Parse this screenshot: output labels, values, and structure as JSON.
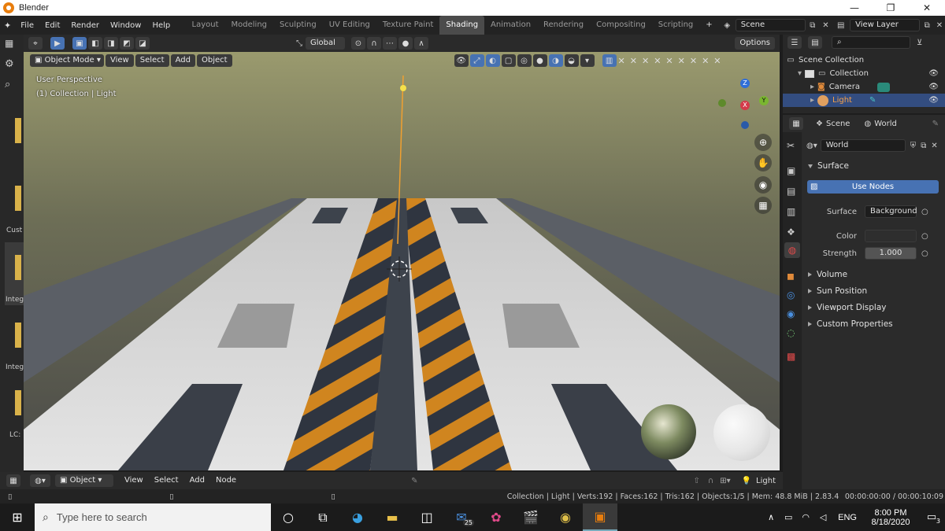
{
  "window": {
    "title": "Blender",
    "minimize": "—",
    "restore": "❐",
    "close": "✕"
  },
  "menu": [
    "File",
    "Edit",
    "Render",
    "Window",
    "Help"
  ],
  "workspaces": [
    "Layout",
    "Modeling",
    "Sculpting",
    "UV Editing",
    "Texture Paint",
    "Shading",
    "Animation",
    "Rendering",
    "Compositing",
    "Scripting"
  ],
  "active_workspace": "Shading",
  "add_tab": "+",
  "scene_field": "Scene",
  "view_layer_field": "View Layer",
  "viewport": {
    "transform_orientation": "Global",
    "options_label": "Options",
    "mode": "Object Mode",
    "menus": [
      "View",
      "Select",
      "Add",
      "Object"
    ],
    "perspective_label": "User Perspective",
    "collection_label": "(1) Collection | Light",
    "gizmo": {
      "z": "Z",
      "x": "X",
      "y": "Y"
    }
  },
  "left_strip_labels": [
    "Cust",
    "Integ",
    "Integ",
    "LC:"
  ],
  "outliner": {
    "root": "Scene Collection",
    "rows": [
      {
        "name": "Collection",
        "selected": false
      },
      {
        "name": "Camera",
        "selected": false
      },
      {
        "name": "Light",
        "selected": true
      }
    ]
  },
  "properties": {
    "breadcrumb_scene": "Scene",
    "breadcrumb_world": "World",
    "world_field": "World",
    "surface_section": "Surface",
    "use_nodes_button": "Use Nodes",
    "surface_label": "Surface",
    "surface_value": "Background",
    "color_label": "Color",
    "strength_label": "Strength",
    "strength_value": "1.000",
    "collapsed_sections": [
      "Volume",
      "Sun Position",
      "Viewport Display",
      "Custom Properties"
    ]
  },
  "node_header": {
    "type": "Object",
    "menus": [
      "View",
      "Select",
      "Add",
      "Node"
    ],
    "object_label": "Light"
  },
  "status": {
    "stats": "Collection | Light | Verts:192 | Faces:162 | Tris:162 | Objects:1/5 | Mem: 48.8 MiB | 2.83.4",
    "timecode": "00:00:00:00 / 00:00:10:09"
  },
  "taskbar": {
    "search_placeholder": "Type here to search",
    "mail_badge": "25",
    "language": "ENG",
    "time": "8:00 PM",
    "date": "8/18/2020",
    "notifications": "3"
  },
  "colors": {
    "accent_blue": "#4772b3",
    "selection": "#334d80",
    "active_orange": "#e87d0d"
  }
}
